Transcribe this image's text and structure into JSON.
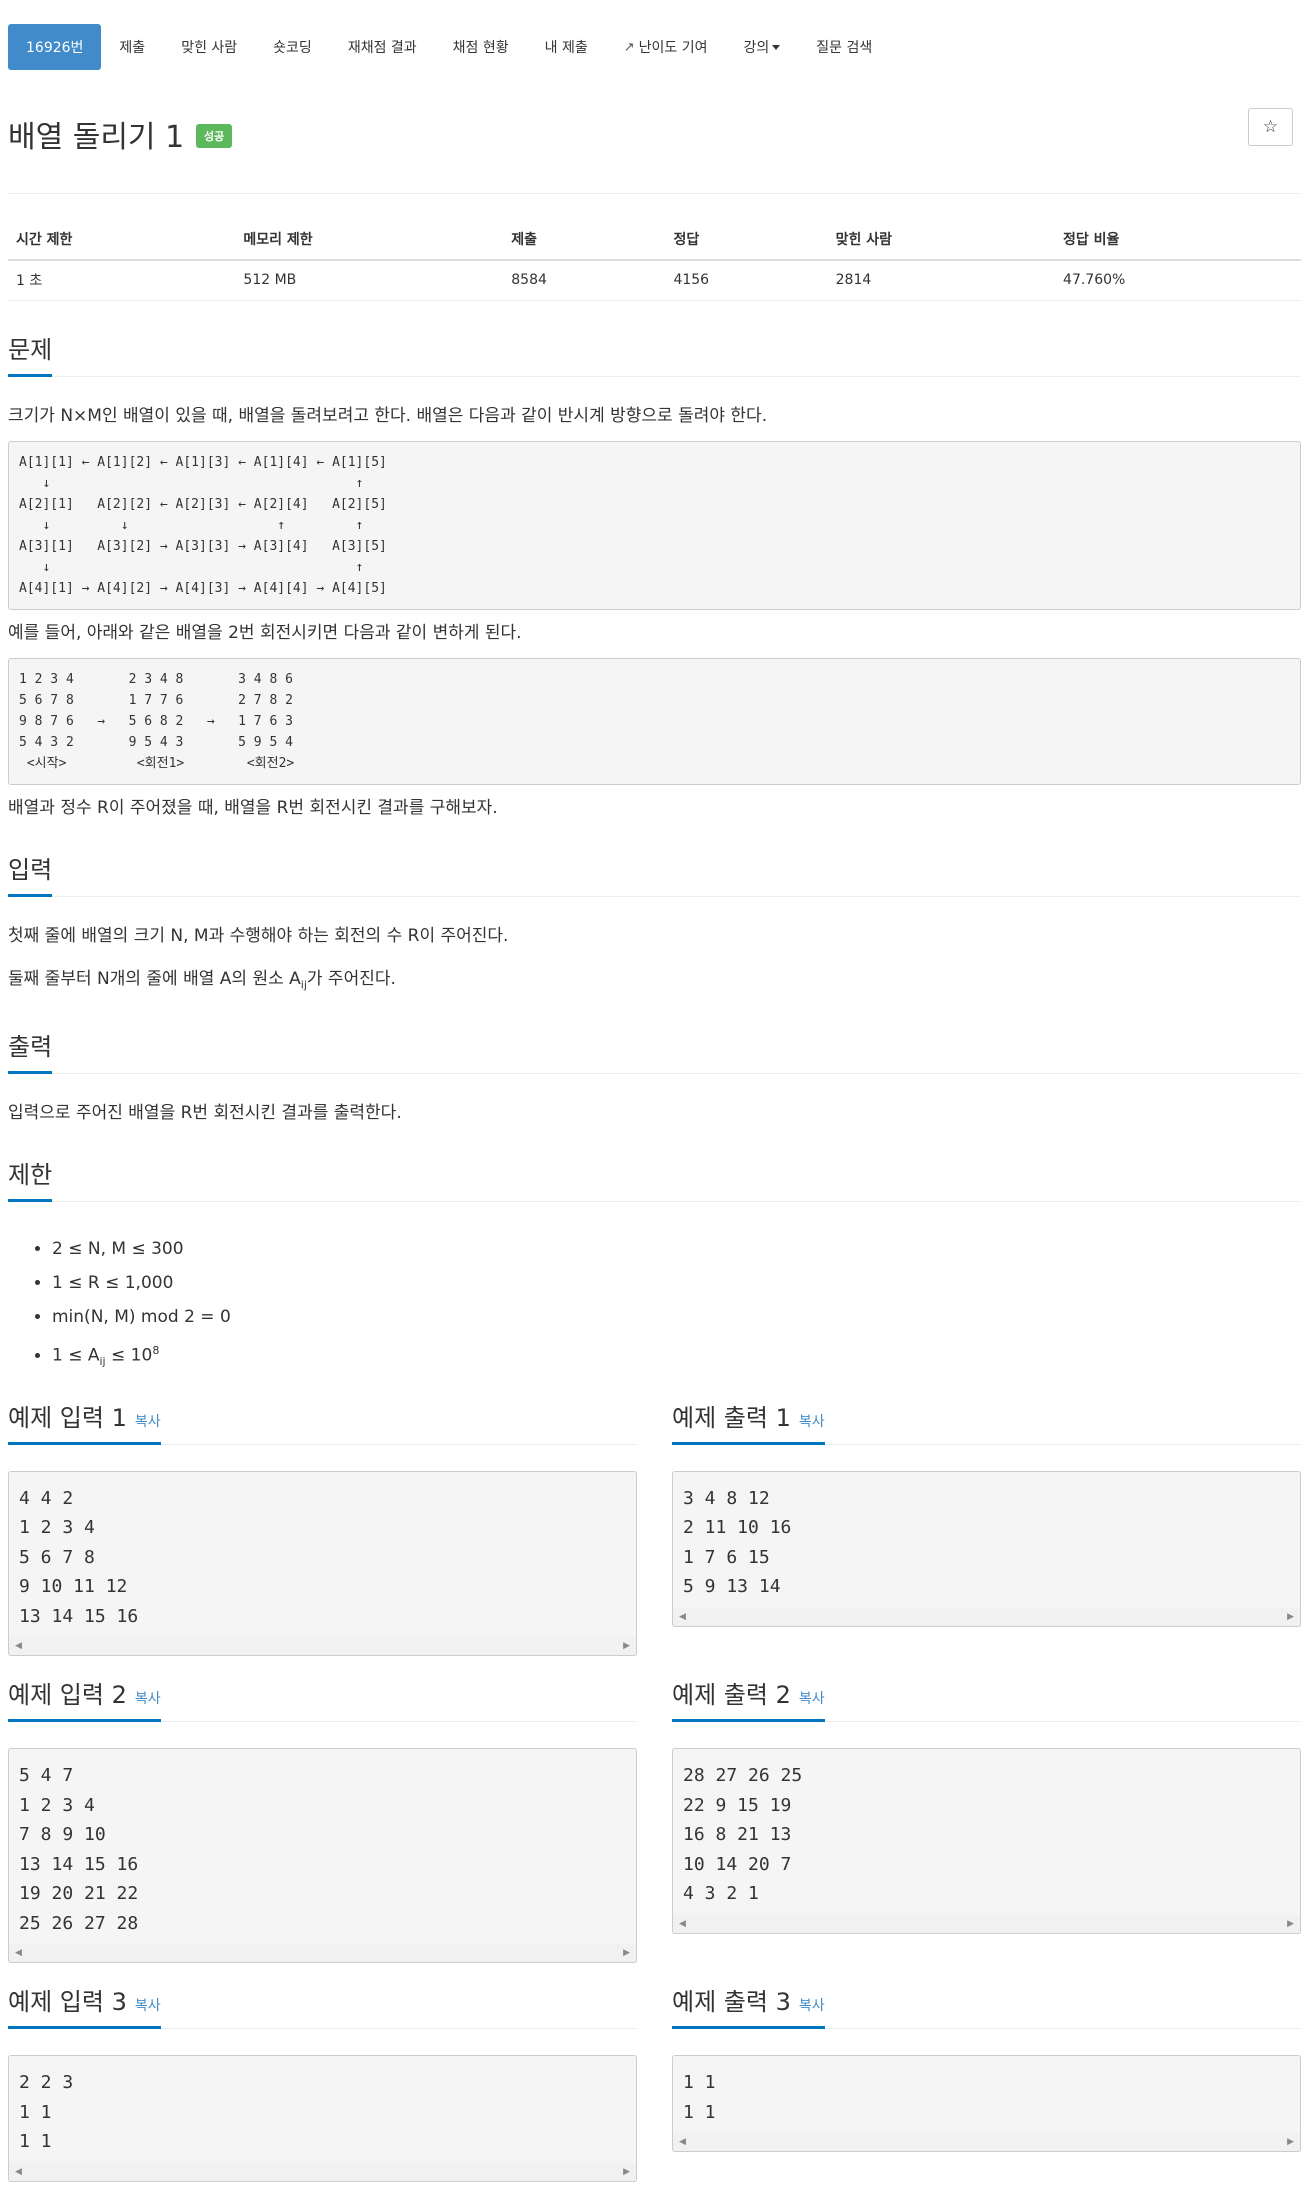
{
  "nav": {
    "items": [
      {
        "label": "16926번",
        "active": true
      },
      {
        "label": "제출"
      },
      {
        "label": "맞힌 사람"
      },
      {
        "label": "숏코딩"
      },
      {
        "label": "재채점 결과"
      },
      {
        "label": "채점 현황"
      },
      {
        "label": "내 제출"
      },
      {
        "label": "난이도 기여"
      },
      {
        "label": "강의"
      },
      {
        "label": "질문 검색"
      }
    ]
  },
  "problem": {
    "title": "배열 돌리기 1",
    "badge": "성공",
    "star_icon": "☆"
  },
  "info": {
    "headers": [
      "시간 제한",
      "메모리 제한",
      "제출",
      "정답",
      "맞힌 사람",
      "정답 비율"
    ],
    "values": [
      "1 초",
      "512 MB",
      "8584",
      "4156",
      "2814",
      "47.760%"
    ]
  },
  "sections": {
    "problem_heading": "문제",
    "problem_p1": "크기가 N×M인 배열이 있을 때, 배열을 돌려보려고 한다. 배열은 다음과 같이 반시계 방향으로 돌려야 한다.",
    "diagram1": "A[1][1] ← A[1][2] ← A[1][3] ← A[1][4] ← A[1][5]\n   ↓                                       ↑\nA[2][1]   A[2][2] ← A[2][3] ← A[2][4]   A[2][5]\n   ↓         ↓                   ↑         ↑\nA[3][1]   A[3][2] → A[3][3] → A[3][4]   A[3][5]\n   ↓                                       ↑\nA[4][1] → A[4][2] → A[4][3] → A[4][4] → A[4][5]",
    "problem_p2": "예를 들어, 아래와 같은 배열을 2번 회전시키면 다음과 같이 변하게 된다.",
    "diagram2": "1 2 3 4       2 3 4 8       3 4 8 6\n5 6 7 8       1 7 7 6       2 7 8 2\n9 8 7 6   →   5 6 8 2   →   1 7 6 3\n5 4 3 2       9 5 4 3       5 9 5 4\n <시작>         <회전1>        <회전2>",
    "problem_p3": "배열과 정수 R이 주어졌을 때, 배열을 R번 회전시킨 결과를 구해보자.",
    "input_heading": "입력",
    "input_p1": "첫째 줄에 배열의 크기 N, M과 수행해야 하는 회전의 수 R이 주어진다.",
    "input_p2_pre": "둘째 줄부터 N개의 줄에 배열 A의 원소 A",
    "input_p2_sub": "ij",
    "input_p2_post": "가 주어진다.",
    "output_heading": "출력",
    "output_p1": "입력으로 주어진 배열을 R번 회전시킨 결과를 출력한다.",
    "limit_heading": "제한",
    "limits": [
      "2 ≤ N, M ≤ 300",
      "1 ≤ R ≤ 1,000",
      "min(N, M) mod 2 = 0"
    ],
    "limit4_pre": "1 ≤ A",
    "limit4_sub": "ij",
    "limit4_mid": " ≤ 10",
    "limit4_sup": "8"
  },
  "samples": {
    "copy_label": "복사",
    "in1_title": "예제 입력 1",
    "in1": "4 4 2\n1 2 3 4\n5 6 7 8\n9 10 11 12\n13 14 15 16",
    "out1_title": "예제 출력 1",
    "out1": "3 4 8 12\n2 11 10 16\n1 7 6 15\n5 9 13 14",
    "in2_title": "예제 입력 2",
    "in2": "5 4 7\n1 2 3 4\n7 8 9 10\n13 14 15 16\n19 20 21 22\n25 26 27 28",
    "out2_title": "예제 출력 2",
    "out2": "28 27 26 25\n22 9 15 19\n16 8 21 13\n10 14 20 7\n4 3 2 1",
    "in3_title": "예제 입력 3",
    "in3": "2 2 3\n1 1\n1 1",
    "out3_title": "예제 출력 3",
    "out3": "1 1\n1 1"
  },
  "colors": {
    "primary": "#428bca",
    "success": "#5cb85c",
    "headline_border": "#0076c0"
  }
}
